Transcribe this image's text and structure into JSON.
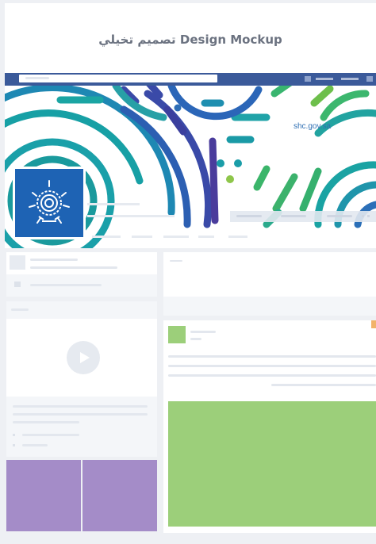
{
  "page_title": "تصميم تخيلي Design Mockup",
  "cover": {
    "url_text": "shc.gov.sa"
  },
  "icons": {
    "logo": "star-rings-logo-icon",
    "play": "play-icon"
  },
  "colors": {
    "page_bg": "#eef0f4",
    "navbar": "#3b5a9a",
    "logo_bg": "#1e63b4",
    "url_text": "#2f6fb3",
    "placeholder_green": "#9ccf7a",
    "placeholder_purple": "#a48cc8",
    "accent_orange": "#f2b36a"
  }
}
